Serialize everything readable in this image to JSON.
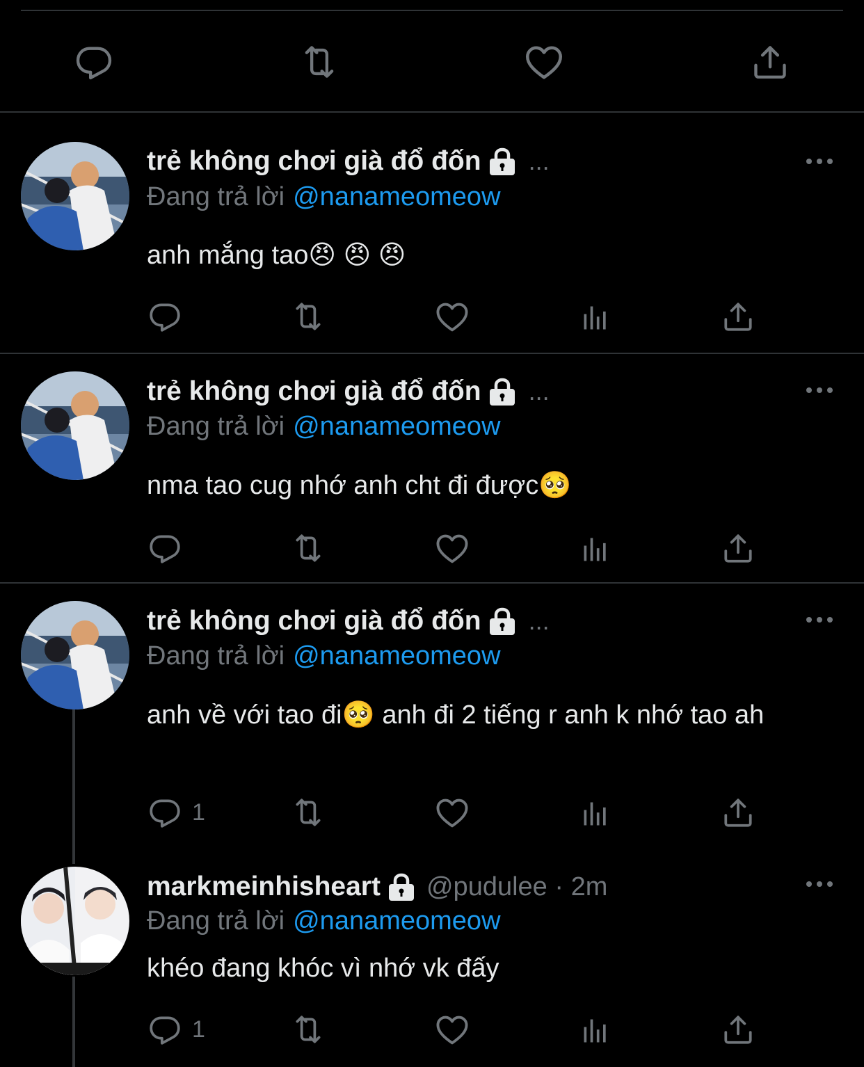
{
  "top_actions": {
    "reply_icon": "reply-icon",
    "retweet_icon": "retweet-icon",
    "like_icon": "heart-icon",
    "share_icon": "share-icon"
  },
  "tweets": [
    {
      "name": "trẻ không chơi già đổ đốn",
      "name_suffix": "...",
      "reply_label": "Đang trả lời",
      "reply_to": "@nanameomeow",
      "text": "anh mắng tao😠 😠 😠",
      "reply_count": ""
    },
    {
      "name": "trẻ không chơi già đổ đốn",
      "name_suffix": "...",
      "reply_label": "Đang trả lời",
      "reply_to": "@nanameomeow",
      "text": "nma tao cug nhớ anh cht đi được🥺",
      "reply_count": ""
    },
    {
      "name": "trẻ không chơi già đổ đốn",
      "name_suffix": "...",
      "reply_label": "Đang trả lời",
      "reply_to": "@nanameomeow",
      "text": "anh về với tao đi🥺 anh đi 2 tiếng r anh k nhớ tao ah",
      "reply_count": "1"
    },
    {
      "name": "markmeinhisheart",
      "handle": "@pudulee · 2m",
      "reply_label": "Đang trả lời",
      "reply_to": "@nanameomeow",
      "text": "khéo đang khóc vì nhớ vk đấy",
      "reply_count": "1"
    }
  ],
  "colors": {
    "background": "#000000",
    "text": "#e7e9ea",
    "muted": "#71767b",
    "link": "#1d9bf0",
    "divider": "#2f3336"
  }
}
